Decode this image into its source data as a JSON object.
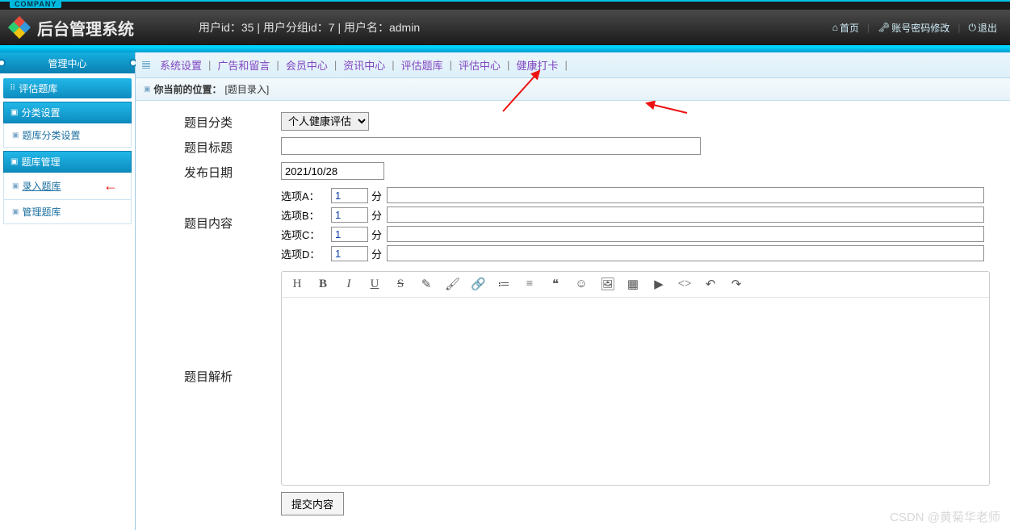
{
  "brand": {
    "tag": "COMPANY",
    "title": "后台管理系统"
  },
  "header": {
    "user_info": "用户id：35 | 用户分组id：7 | 用户名：admin",
    "links": {
      "home": "首页",
      "pwd": "账号密码修改",
      "logout": "退出"
    }
  },
  "sidebar": {
    "tab": "管理中心",
    "module": "评估题库",
    "sections": [
      {
        "title": "分类设置",
        "items": [
          {
            "label": "题库分类设置",
            "active": false
          }
        ]
      },
      {
        "title": "题库管理",
        "items": [
          {
            "label": "录入题库",
            "active": true
          },
          {
            "label": "管理题库",
            "active": false
          }
        ]
      }
    ]
  },
  "topnav": {
    "items": [
      "系统设置",
      "广告和留言",
      "会员中心",
      "资讯中心",
      "评估题库",
      "评估中心",
      "健康打卡"
    ]
  },
  "breadcrumb": {
    "prefix": "你当前的位置：",
    "current": "[题目录入]"
  },
  "form": {
    "labels": {
      "category": "题目分类",
      "title": "题目标题",
      "date": "发布日期",
      "content": "题目内容",
      "analysis": "题目解析"
    },
    "category_selected": "个人健康评估",
    "title_value": "",
    "date_value": "2021/10/28",
    "options": [
      {
        "name": "选项A：",
        "score": "1",
        "unit": "分",
        "text": ""
      },
      {
        "name": "选项B：",
        "score": "1",
        "unit": "分",
        "text": ""
      },
      {
        "name": "选项C：",
        "score": "1",
        "unit": "分",
        "text": ""
      },
      {
        "name": "选项D：",
        "score": "1",
        "unit": "分",
        "text": ""
      }
    ],
    "submit": "提交内容"
  },
  "toolbar_icons": [
    "H",
    "B",
    "I",
    "U",
    "S",
    "✎",
    "🖌",
    "🔗",
    "≔",
    "≡",
    "❝",
    "☺",
    "🖼",
    "▦",
    "▶",
    "<>",
    "↶",
    "↷"
  ],
  "watermark": "CSDN @黄菊华老师"
}
